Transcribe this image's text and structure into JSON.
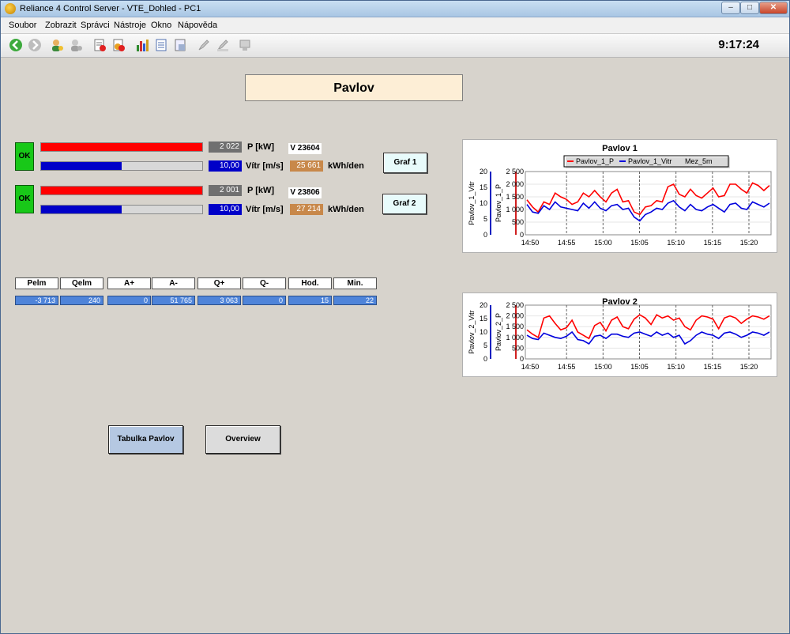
{
  "window": {
    "title": "Reliance 4 Control Server - VTE_Dohled - PC1",
    "minimize": "–",
    "maximize": "□",
    "close": "✕"
  },
  "menu": [
    "Soubor",
    "Zobrazit",
    "Správci",
    "Nástroje",
    "Okno",
    "Nápověda"
  ],
  "toolbar": {
    "icons": [
      "back-icon",
      "forward-icon",
      "user-login-icon",
      "user-logout-icon",
      "alarm-list-icon",
      "alarm-ack-icon",
      "chart-icon",
      "report-icon",
      "print-icon",
      "edit-icon",
      "edit2-icon",
      "runtime-icon"
    ],
    "clock": "9:17:24"
  },
  "station": {
    "title": "Pavlov",
    "units": [
      {
        "status": "OK",
        "power_value": "2 022",
        "power_label": "P [kW]",
        "power_fraction": 1.0,
        "wind_value": "10,00",
        "wind_label": "Vítr [m/s]",
        "wind_fraction": 0.5,
        "version": "V 23604",
        "energy_value": "25 661",
        "energy_label": "kWh/den",
        "graph_button": "Graf 1"
      },
      {
        "status": "OK",
        "power_value": "2 001",
        "power_label": "P [kW]",
        "power_fraction": 1.0,
        "wind_value": "10,00",
        "wind_label": "Vítr [m/s]",
        "wind_fraction": 0.5,
        "version": "V 23806",
        "energy_value": "27 214",
        "energy_label": "kWh/den",
        "graph_button": "Graf 2"
      }
    ],
    "colors": {
      "power_bar": "#ff0000",
      "wind_bar": "#0000c8",
      "ok": "#18c818",
      "energy_box": "#c8884a",
      "power_box": "#707070",
      "wind_box": "#0000c8"
    }
  },
  "meter_table": {
    "headers": [
      "Pelm",
      "Qelm",
      "A+",
      "A-",
      "Q+",
      "Q-",
      "Hod.",
      "Min."
    ],
    "values": [
      "-3 713",
      "240",
      "0",
      "51 765",
      "3 063",
      "0",
      "15",
      "22"
    ]
  },
  "buttons": {
    "table": "Tabulka Pavlov",
    "overview": "Overview"
  },
  "chart_data": [
    {
      "type": "line",
      "title": "Pavlov 1",
      "legend": [
        "Pavlov_1_P",
        "Pavlov_1_Vitr",
        "Mez_5m"
      ],
      "left_axis_label": "Pavlov_1_Vitr",
      "right_axis_label": "Pavlov_1_P",
      "wind_ticks": [
        "20",
        "15",
        "10",
        "5",
        "0"
      ],
      "power_ticks": [
        "2 500",
        "2 000",
        "1 500",
        "1 000",
        "500",
        "0"
      ],
      "x_ticks": [
        "14:50",
        "14:55",
        "15:00",
        "15:05",
        "15:10",
        "15:15",
        "15:20"
      ],
      "ylim_power": [
        0,
        2500
      ],
      "ylim_wind": [
        0,
        20
      ],
      "series_colors": {
        "P": "#ff0000",
        "Vitr": "#0000dd"
      },
      "series": [
        {
          "name": "Pavlov_1_P",
          "values": [
            1380,
            1100,
            900,
            1300,
            1200,
            1650,
            1500,
            1400,
            1200,
            1300,
            1650,
            1500,
            1750,
            1500,
            1300,
            1650,
            1800,
            1300,
            1350,
            900,
            800,
            1100,
            1150,
            1350,
            1300,
            1900,
            2000,
            1600,
            1500,
            1800,
            1550,
            1450,
            1650,
            1850,
            1500,
            1550,
            2000,
            2000,
            1800,
            1650,
            2050,
            1950,
            1750,
            1950
          ]
        },
        {
          "name": "Pavlov_1_Vitr",
          "values": [
            1200,
            900,
            850,
            1150,
            1000,
            1300,
            1100,
            1050,
            1000,
            950,
            1250,
            1050,
            1300,
            1050,
            950,
            1150,
            1200,
            1000,
            1050,
            700,
            550,
            800,
            900,
            1050,
            1000,
            1250,
            1350,
            1100,
            950,
            1200,
            1000,
            950,
            1100,
            1200,
            1050,
            900,
            1200,
            1250,
            1050,
            1000,
            1300,
            1200,
            1100,
            1250
          ]
        }
      ]
    },
    {
      "type": "line",
      "title": "Pavlov 2",
      "left_axis_label": "Pavlov_2_Vitr",
      "right_axis_label": "Pavlov_2_P",
      "wind_ticks": [
        "20",
        "15",
        "10",
        "5",
        "0"
      ],
      "power_ticks": [
        "2 500",
        "2 000",
        "1 500",
        "1 000",
        "500",
        "0"
      ],
      "x_ticks": [
        "14:50",
        "14:55",
        "15:00",
        "15:05",
        "15:10",
        "15:15",
        "15:20"
      ],
      "ylim_power": [
        0,
        2500
      ],
      "ylim_wind": [
        0,
        20
      ],
      "series_colors": {
        "P": "#ff0000",
        "Vitr": "#0000dd"
      },
      "series": [
        {
          "name": "Pavlov_2_P",
          "values": [
            1350,
            1150,
            1000,
            1900,
            2000,
            1650,
            1350,
            1450,
            1800,
            1250,
            1100,
            950,
            1550,
            1700,
            1300,
            1800,
            1950,
            1500,
            1400,
            1850,
            2050,
            1900,
            1600,
            2050,
            1900,
            2000,
            1800,
            1900,
            1500,
            1350,
            1800,
            2000,
            1950,
            1850,
            1400,
            1900,
            2000,
            1900,
            1650,
            1850,
            2000,
            1950,
            1850,
            2000
          ]
        },
        {
          "name": "Pavlov_2_Vitr",
          "values": [
            1100,
            950,
            900,
            1200,
            1100,
            1000,
            950,
            1050,
            1250,
            900,
            850,
            700,
            1050,
            1100,
            950,
            1150,
            1150,
            1050,
            1000,
            1200,
            1250,
            1150,
            1050,
            1250,
            1100,
            1200,
            1000,
            1100,
            700,
            850,
            1100,
            1250,
            1150,
            1100,
            950,
            1200,
            1250,
            1150,
            1000,
            1100,
            1250,
            1200,
            1100,
            1250
          ]
        }
      ]
    }
  ]
}
